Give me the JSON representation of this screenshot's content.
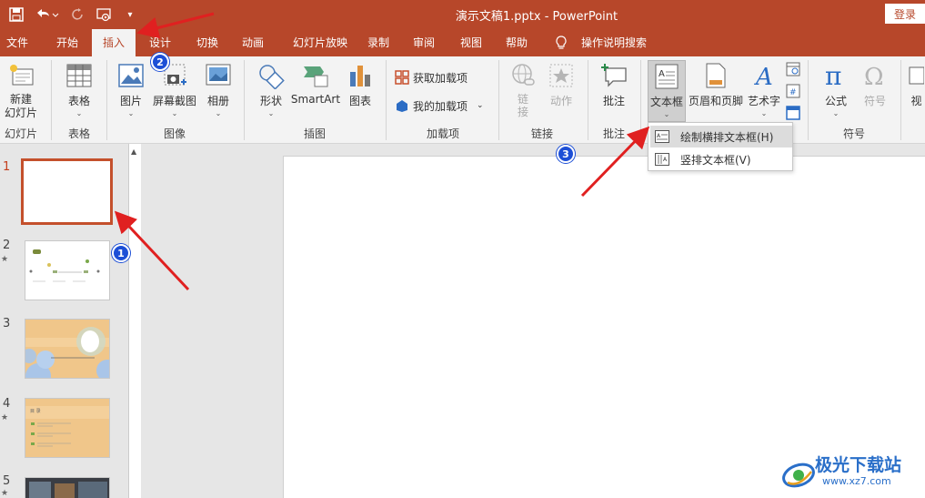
{
  "app": {
    "doc_title": "演示文稿1.pptx  -  PowerPoint",
    "login_label": "登录",
    "accent_color": "#b7472a"
  },
  "quick_access": {
    "icons": [
      "save-icon",
      "undo-icon",
      "redo-icon",
      "present-from-start-icon",
      "customize-icon"
    ]
  },
  "tabs": [
    "文件",
    "开始",
    "插入",
    "设计",
    "切换",
    "动画",
    "幻灯片放映",
    "录制",
    "审阅",
    "视图",
    "帮助"
  ],
  "active_tab": "插入",
  "tell_me": "操作说明搜索",
  "ribbon": {
    "new_slide": "新建\n幻灯片",
    "table": "表格",
    "picture": "图片",
    "screenshot": "屏幕截图",
    "album": "相册",
    "shapes": "形状",
    "smartart": "SmartArt",
    "chart": "图表",
    "get_addins": "获取加载项",
    "my_addins": "我的加载项",
    "link": "链\n接",
    "action": "动作",
    "comment": "批注",
    "textbox": "文本框",
    "header_footer": "页眉和页脚",
    "wordart": "艺术字",
    "equation": "公式",
    "symbol": "符号",
    "video_cut": "视",
    "groups": {
      "slides": "幻灯片",
      "tables": "表格",
      "images": "图像",
      "illustrations": "插图",
      "addins": "加载项",
      "links": "链接",
      "comments": "批注",
      "symbols": "符号"
    }
  },
  "textbox_menu": {
    "items": [
      "绘制横排文本框(H)",
      "竖排文本框(V)"
    ]
  },
  "slides": [
    {
      "num": "1",
      "star": ""
    },
    {
      "num": "2",
      "star": "★"
    },
    {
      "num": "3",
      "star": ""
    },
    {
      "num": "4",
      "star": "★"
    },
    {
      "num": "5",
      "star": "★"
    }
  ],
  "thumb4_title": "目 录",
  "annotations": [
    "1",
    "2",
    "3"
  ],
  "watermark": {
    "name": "极光下载站",
    "url": "www.xz7.com"
  }
}
